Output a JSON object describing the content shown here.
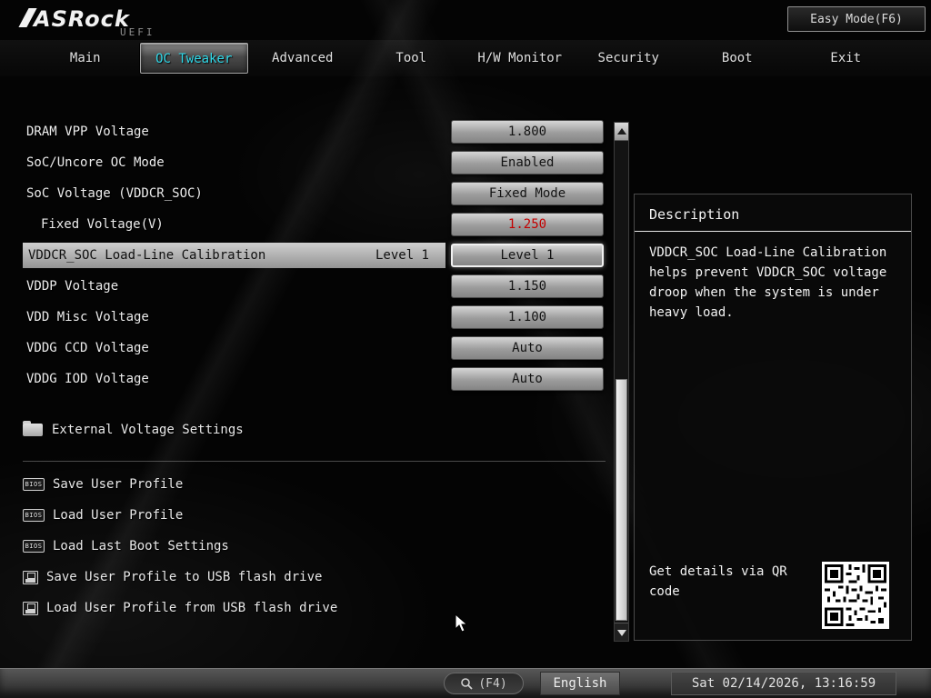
{
  "header": {
    "logo": "ASRock",
    "logo_sub": "UEFI",
    "easy_mode_label": "Easy Mode(F6)"
  },
  "tabs": [
    {
      "label": "Main"
    },
    {
      "label": "OC Tweaker"
    },
    {
      "label": "Advanced"
    },
    {
      "label": "Tool"
    },
    {
      "label": "H/W Monitor"
    },
    {
      "label": "Security"
    },
    {
      "label": "Boot"
    },
    {
      "label": "Exit"
    }
  ],
  "settings": [
    {
      "label": "DRAM VPP Voltage",
      "value": "1.800"
    },
    {
      "label": "SoC/Uncore OC Mode",
      "value": "Enabled"
    },
    {
      "label": "SoC Voltage (VDDCR_SOC)",
      "value": "Fixed Mode"
    },
    {
      "label": "Fixed Voltage(V)",
      "value": "1.250"
    },
    {
      "label": "VDDCR_SOC Load-Line Calibration",
      "value": "Level 1"
    },
    {
      "label": "VDDP Voltage",
      "value": "1.150"
    },
    {
      "label": "VDD Misc Voltage",
      "value": "1.100"
    },
    {
      "label": "VDDG CCD Voltage",
      "value": "Auto"
    },
    {
      "label": "VDDG IOD Voltage",
      "value": "Auto"
    }
  ],
  "folder_item": {
    "label": "External Voltage Settings"
  },
  "profile_items": [
    {
      "label": "Save User Profile"
    },
    {
      "label": "Load User Profile"
    },
    {
      "label": "Load Last Boot Settings"
    },
    {
      "label": "Save User Profile to USB flash drive"
    },
    {
      "label": "Load User Profile from USB flash drive"
    }
  ],
  "description": {
    "title": "Description",
    "text": "VDDCR_SOC Load-Line Calibration helps prevent VDDCR_SOC voltage droop when the system is under heavy load.",
    "qr_label": "Get details via QR code"
  },
  "statusbar": {
    "search_label": "(F4)",
    "language": "English",
    "datetime": "Sat 02/14/2026, 13:16:59"
  },
  "icons": {
    "bios_chip_text": "BIOS"
  },
  "colors": {
    "accent_cyan": "#2fd8e8",
    "value_red": "#c40000"
  }
}
